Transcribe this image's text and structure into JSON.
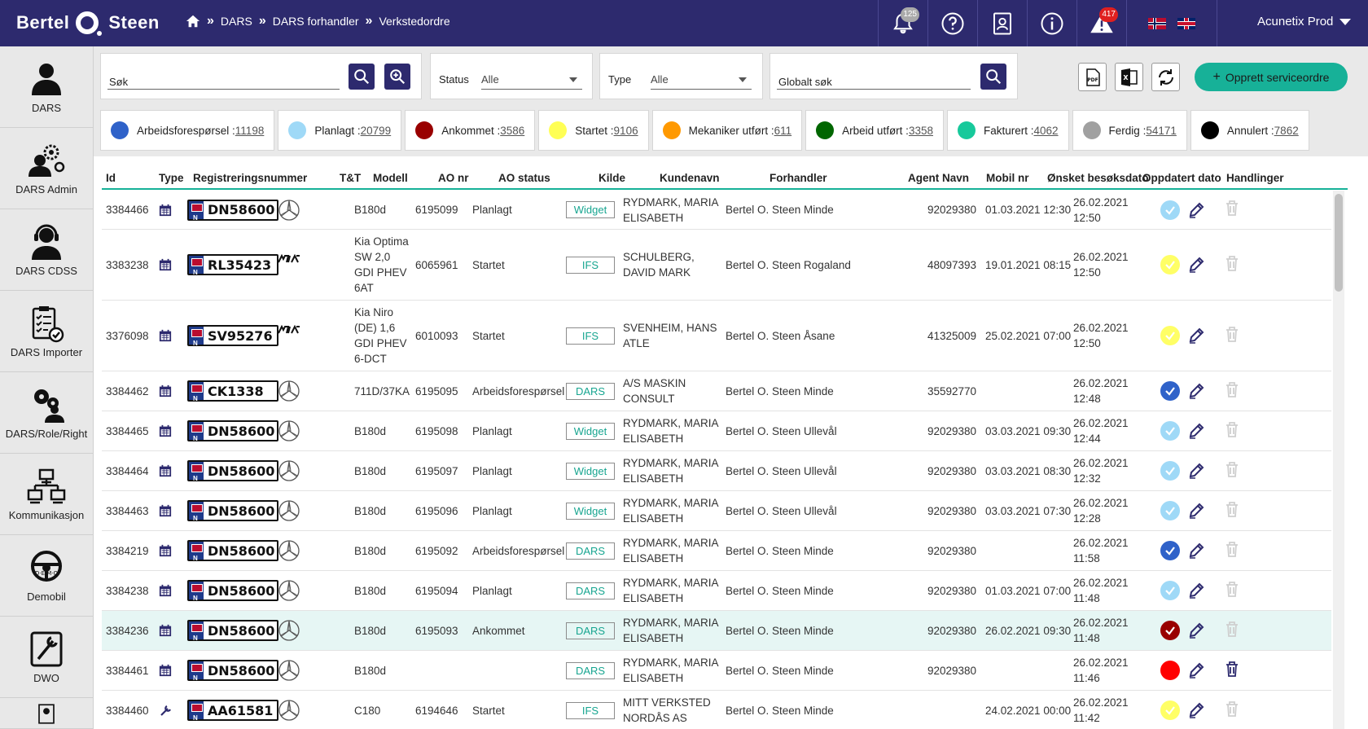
{
  "header": {
    "logo_left": "Bertel",
    "logo_right": "Steen",
    "breadcrumbs": [
      "DARS",
      "DARS forhandler",
      "Verkstedordre"
    ],
    "notifications_count": "125",
    "alerts_count": "417",
    "user": "Acunetix Prod"
  },
  "sidebar": {
    "items": [
      {
        "label": "DARS",
        "icon": "user-icon"
      },
      {
        "label": "DARS Admin",
        "icon": "gear-person-icon"
      },
      {
        "label": "DARS CDSS",
        "icon": "headset-icon"
      },
      {
        "label": "DARS Importer",
        "icon": "clipboard-check-icon"
      },
      {
        "label": "DARS/Role/Right",
        "icon": "gears-person-icon"
      },
      {
        "label": "Kommunikasjon",
        "icon": "network-icon"
      },
      {
        "label": "Demobil",
        "icon": "steering-wheel-icon"
      },
      {
        "label": "DWO",
        "icon": "tools-icon"
      }
    ]
  },
  "filters": {
    "search_label": "Søk",
    "status_label": "Status",
    "status_value": "Alle",
    "type_label": "Type",
    "type_value": "Alle",
    "global_label": "Globalt søk",
    "create_label": "Opprett serviceordre"
  },
  "status_chips": [
    {
      "label": "Arbeidsforespørsel :",
      "count": "11198",
      "color": "#2f62c9"
    },
    {
      "label": "Planlagt :",
      "count": "20799",
      "color": "#9fd9f7"
    },
    {
      "label": "Ankommet :",
      "count": "3586",
      "color": "#990000"
    },
    {
      "label": "Startet :",
      "count": "9106",
      "color": "#ffff55"
    },
    {
      "label": "Mekaniker utført :",
      "count": "611",
      "color": "#ff9900"
    },
    {
      "label": "Arbeid utført :",
      "count": "3358",
      "color": "#006600"
    },
    {
      "label": "Fakturert :",
      "count": "4062",
      "color": "#17c99b"
    },
    {
      "label": "Ferdig :",
      "count": "54171",
      "color": "#a0a0a0"
    },
    {
      "label": "Annulert :",
      "count": "7862",
      "color": "#000000"
    }
  ],
  "table": {
    "headers": {
      "id": "Id",
      "type": "Type",
      "reg": "Registreringsnummer",
      "tt": "T&T",
      "model": "Modell",
      "ao": "AO nr",
      "ao_status": "AO status",
      "source": "Kilde",
      "customer": "Kundenavn",
      "dealer": "Forhandler",
      "agent": "Agent Navn",
      "mobile": "Mobil nr",
      "wish": "Ønsket besøksdato",
      "updated": "Oppdatert dato",
      "actions": "Handlinger"
    },
    "rows": [
      {
        "id": "3384466",
        "reg": "DN58600",
        "brand": "mercedes",
        "model": [
          "B180d"
        ],
        "ao": "6195099",
        "status": "Planlagt",
        "source": "Widget",
        "customer": [
          "RYDMARK, MARIA",
          "ELISABETH"
        ],
        "dealer": "Bertel O. Steen Minde",
        "mobile": "92029380",
        "wish": "01.03.2021 12:30",
        "updated": [
          "26.02.2021",
          "12:50"
        ],
        "color": "#9fd9f7",
        "check": true,
        "del": false,
        "h": 48
      },
      {
        "id": "3383238",
        "reg": "RL35423",
        "brand": "kia",
        "model": [
          "Kia Optima",
          "SW 2,0",
          "GDI PHEV",
          "6AT"
        ],
        "ao": "6065961",
        "status": "Startet",
        "source": "IFS",
        "customer": [
          "SCHULBERG,",
          "DAVID MARK"
        ],
        "dealer": "Bertel O. Steen Rogaland",
        "mobile": "48097393",
        "wish": "19.01.2021 08:15",
        "updated": [
          "26.02.2021",
          "12:50"
        ],
        "color": "#ffff66",
        "check": true,
        "del": false,
        "h": 87
      },
      {
        "id": "3376098",
        "reg": "SV95276",
        "brand": "kia",
        "model": [
          "Kia Niro",
          "(DE) 1,6",
          "GDI PHEV",
          "6-DCT"
        ],
        "ao": "6010093",
        "status": "Startet",
        "source": "IFS",
        "customer": [
          "SVENHEIM, HANS",
          "ATLE"
        ],
        "dealer": "Bertel O. Steen Åsane",
        "mobile": "41325009",
        "wish": "25.02.2021 07:00",
        "updated": [
          "26.02.2021",
          "12:50"
        ],
        "color": "#ffff66",
        "check": true,
        "del": false,
        "h": 87
      },
      {
        "id": "3384462",
        "reg": "CK1338",
        "brand": "mercedes",
        "model": [
          "711D/37KA"
        ],
        "ao": "6195095",
        "status": "Arbeidsforespørsel",
        "source": "DARS",
        "customer": [
          "A/S MASKIN",
          "CONSULT"
        ],
        "dealer": "Bertel O. Steen Minde",
        "mobile": "35592770",
        "wish": "",
        "updated": [
          "26.02.2021",
          "12:48"
        ],
        "color": "#2f62c9",
        "check": true,
        "del": false,
        "h": 49
      },
      {
        "id": "3384465",
        "reg": "DN58600",
        "brand": "mercedes",
        "model": [
          "B180d"
        ],
        "ao": "6195098",
        "status": "Planlagt",
        "source": "Widget",
        "customer": [
          "RYDMARK, MARIA",
          "ELISABETH"
        ],
        "dealer": "Bertel O. Steen Ullevål",
        "mobile": "92029380",
        "wish": "03.03.2021 09:30",
        "updated": [
          "26.02.2021",
          "12:44"
        ],
        "color": "#9fd9f7",
        "check": true,
        "del": false,
        "h": 49
      },
      {
        "id": "3384464",
        "reg": "DN58600",
        "brand": "mercedes",
        "model": [
          "B180d"
        ],
        "ao": "6195097",
        "status": "Planlagt",
        "source": "Widget",
        "customer": [
          "RYDMARK, MARIA",
          "ELISABETH"
        ],
        "dealer": "Bertel O. Steen Ullevål",
        "mobile": "92029380",
        "wish": "03.03.2021 08:30",
        "updated": [
          "26.02.2021",
          "12:32"
        ],
        "color": "#9fd9f7",
        "check": true,
        "del": false,
        "h": 49
      },
      {
        "id": "3384463",
        "reg": "DN58600",
        "brand": "mercedes",
        "model": [
          "B180d"
        ],
        "ao": "6195096",
        "status": "Planlagt",
        "source": "Widget",
        "customer": [
          "RYDMARK, MARIA",
          "ELISABETH"
        ],
        "dealer": "Bertel O. Steen Ullevål",
        "mobile": "92029380",
        "wish": "03.03.2021 07:30",
        "updated": [
          "26.02.2021",
          "12:28"
        ],
        "color": "#9fd9f7",
        "check": true,
        "del": false,
        "h": 49
      },
      {
        "id": "3384219",
        "reg": "DN58600",
        "brand": "mercedes",
        "model": [
          "B180d"
        ],
        "ao": "6195092",
        "status": "Arbeidsforespørsel",
        "source": "DARS",
        "customer": [
          "RYDMARK, MARIA",
          "ELISABETH"
        ],
        "dealer": "Bertel O. Steen Minde",
        "mobile": "92029380",
        "wish": "",
        "updated": [
          "26.02.2021",
          "11:58"
        ],
        "color": "#2f62c9",
        "check": true,
        "del": false,
        "h": 49
      },
      {
        "id": "3384238",
        "reg": "DN58600",
        "brand": "mercedes",
        "model": [
          "B180d"
        ],
        "ao": "6195094",
        "status": "Planlagt",
        "source": "DARS",
        "customer": [
          "RYDMARK, MARIA",
          "ELISABETH"
        ],
        "dealer": "Bertel O. Steen Minde",
        "mobile": "92029380",
        "wish": "01.03.2021 07:00",
        "updated": [
          "26.02.2021",
          "11:48"
        ],
        "color": "#9fd9f7",
        "check": true,
        "del": false,
        "h": 49
      },
      {
        "id": "3384236",
        "reg": "DN58600",
        "brand": "mercedes",
        "model": [
          "B180d"
        ],
        "ao": "6195093",
        "status": "Ankommet",
        "source": "DARS",
        "customer": [
          "RYDMARK, MARIA",
          "ELISABETH"
        ],
        "dealer": "Bertel O. Steen Minde",
        "mobile": "92029380",
        "wish": "26.02.2021 09:30",
        "updated": [
          "26.02.2021",
          "11:48"
        ],
        "color": "#990000",
        "check": true,
        "del": false,
        "h": 49,
        "hl": true
      },
      {
        "id": "3384461",
        "reg": "DN58600",
        "brand": "mercedes",
        "model": [
          "B180d"
        ],
        "ao": "",
        "status": "",
        "source": "DARS",
        "customer": [
          "RYDMARK, MARIA",
          "ELISABETH"
        ],
        "dealer": "Bertel O. Steen Minde",
        "mobile": "92029380",
        "wish": "",
        "updated": [
          "26.02.2021",
          "11:46"
        ],
        "color": "#ff0000",
        "check": false,
        "del": true,
        "h": 49
      },
      {
        "id": "3384460",
        "reg": "AA61581",
        "brand": "mercedes",
        "model": [
          "C180"
        ],
        "ao": "6194646",
        "status": "Startet",
        "source": "IFS",
        "customer": [
          "MITT VERKSTED",
          "NORDÅS AS"
        ],
        "dealer": "Bertel O. Steen Minde",
        "mobile": "",
        "wish": "24.02.2021 00:00",
        "updated": [
          "26.02.2021",
          "11:42"
        ],
        "color": "#ffff66",
        "check": true,
        "del": false,
        "h": 49,
        "typeicon": "tool"
      }
    ]
  }
}
